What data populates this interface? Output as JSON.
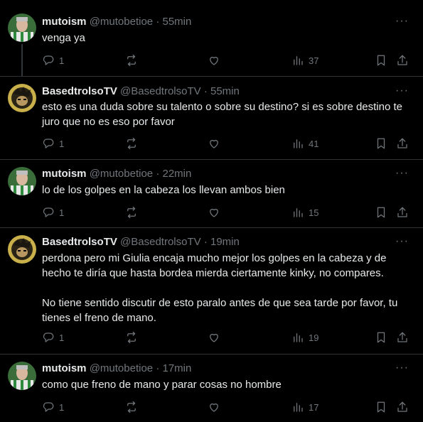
{
  "tweets": [
    {
      "name": "mutoism",
      "handle": "@mutobetioe",
      "time": "55min",
      "text": [
        "venga ya"
      ],
      "replies": "1",
      "views": "37",
      "avatar": "mutoism"
    },
    {
      "name": "BasedtrolsoTV",
      "handle": "@BasedtrolsoTV",
      "time": "55min",
      "text": [
        "esto es una duda sobre su talento o sobre su destino? si es sobre destino te juro que no es eso por favor"
      ],
      "replies": "1",
      "views": "41",
      "avatar": "based"
    },
    {
      "name": "mutoism",
      "handle": "@mutobetioe",
      "time": "22min",
      "text": [
        "lo de los golpes en la cabeza los llevan ambos bien"
      ],
      "replies": "1",
      "views": "15",
      "avatar": "mutoism"
    },
    {
      "name": "BasedtrolsoTV",
      "handle": "@BasedtrolsoTV",
      "time": "19min",
      "text": [
        "perdona pero mi Giulia encaja mucho mejor los golpes en la cabeza y de hecho te diría que hasta bordea mierda ciertamente kinky, no compares.",
        "No tiene sentido discutir de esto paralo antes de que sea tarde por favor, tu tienes el freno de mano."
      ],
      "replies": "1",
      "views": "19",
      "avatar": "based"
    },
    {
      "name": "mutoism",
      "handle": "@mutobetioe",
      "time": "17min",
      "text": [
        "como que freno de mano y parar cosas no hombre"
      ],
      "replies": "1",
      "views": "17",
      "avatar": "mutoism"
    }
  ],
  "separator": "·",
  "more_label": "···"
}
